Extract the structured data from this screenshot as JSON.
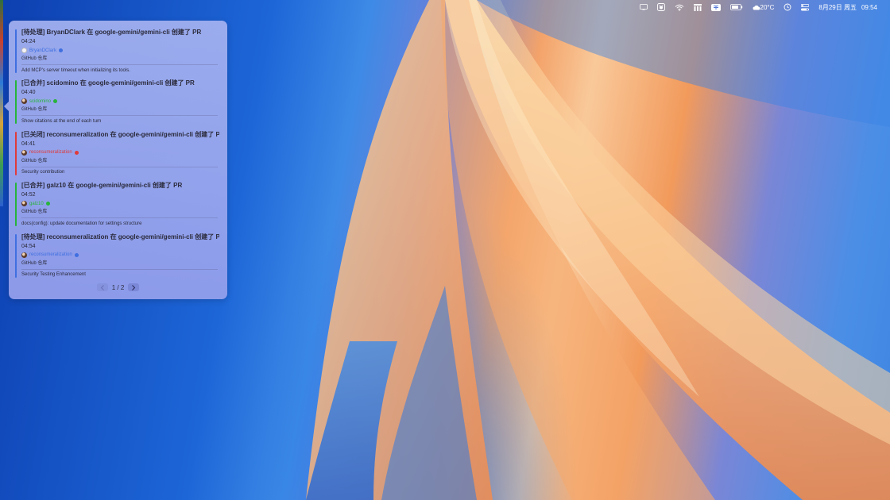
{
  "menubar": {
    "weather": "20°C",
    "date": "8月29日 周五",
    "time": "09:54",
    "icons": [
      "display-icon",
      "github-icon",
      "wifi-icon",
      "app-grid-icon",
      "input-method-icon",
      "battery-icon",
      "weather-cloud-icon",
      "clock-icon",
      "control-center-icon"
    ]
  },
  "panel": {
    "entries": [
      {
        "title": "[待处理] BryanDClark 在 google-gemini/gemini-cli 创建了 PR",
        "time": "04:24",
        "user": "BryanDClark",
        "source": "GitHub 仓库",
        "desc": "Add MCP's server timeout when initializing its tools.",
        "state": "pending",
        "color": "#3f6fe0"
      },
      {
        "title": "[已合并] scidomino 在 google-gemini/gemini-cli 创建了 PR",
        "time": "04:40",
        "user": "scidomino",
        "source": "GitHub 仓库",
        "desc": "Show citations at the end of each turn",
        "state": "merged",
        "color": "#27b43a"
      },
      {
        "title": "[已关闭] reconsumeralization 在 google-gemini/gemini-cli 创建了 PR",
        "time": "04:41",
        "user": "reconsumeralization",
        "source": "GitHub 仓库",
        "desc": "Security contribution",
        "state": "closed",
        "color": "#e03a3a"
      },
      {
        "title": "[已合并] galz10 在 google-gemini/gemini-cli 创建了 PR",
        "time": "04:52",
        "user": "galz10",
        "source": "GitHub 仓库",
        "desc": "docs(config): update documentation for  settings structure",
        "state": "merged",
        "color": "#27b43a"
      },
      {
        "title": "[待处理] reconsumeralization 在 google-gemini/gemini-cli 创建了 PR",
        "time": "04:54",
        "user": "reconsumeralization",
        "source": "GitHub 仓库",
        "desc": "Security Testing Enhancement",
        "state": "pending",
        "color": "#3f6fe0"
      }
    ],
    "pager": {
      "text": "1 / 2"
    }
  }
}
